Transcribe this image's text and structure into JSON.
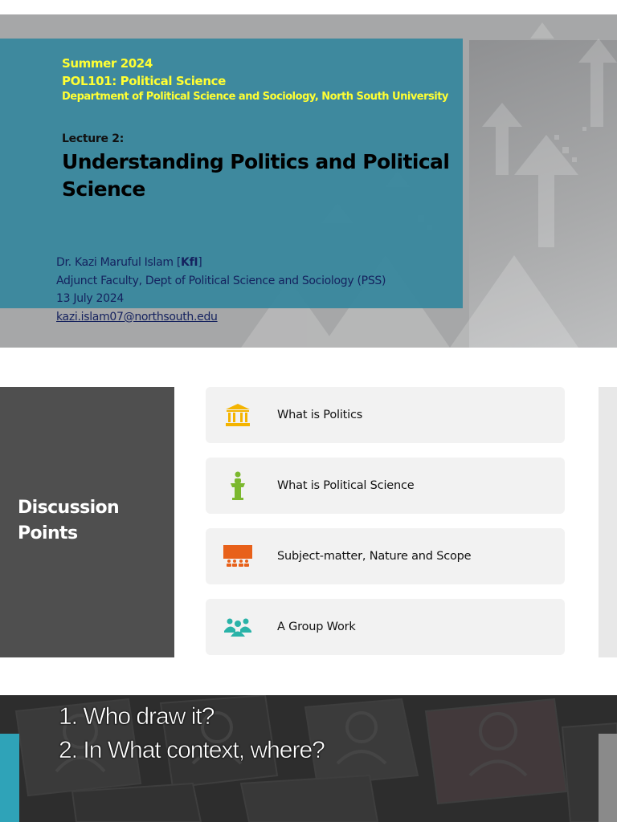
{
  "slide1": {
    "term": "Summer 2024",
    "course": "POL101: Political Science",
    "department": "Department of Political Science and Sociology, North South University",
    "lecture_label": "Lecture 2:",
    "title": "Understanding Politics and Political Science",
    "author_prefix": "Dr. Kazi Maruful Islam [",
    "author_initials": "KfI",
    "author_suffix": "]",
    "position": "Adjunct Faculty, Dept of Political Science and Sociology (PSS)",
    "date": "13 July 2024",
    "email": "kazi.islam07@northsouth.edu",
    "colors": {
      "accent_text": "#ffff33",
      "panel": "#36869d",
      "author_text": "#14215e"
    }
  },
  "slide2": {
    "heading": "Discussion Points",
    "items": [
      {
        "label": "What is Politics",
        "icon": "government-building-icon",
        "color": "#f4b400"
      },
      {
        "label": "What is Political Science",
        "icon": "lectern-speaker-icon",
        "color": "#7cb82f"
      },
      {
        "label": "Subject-matter, Nature and Scope",
        "icon": "presentation-audience-icon",
        "color": "#e8611a"
      },
      {
        "label": "A Group Work",
        "icon": "group-people-icon",
        "color": "#2ab3a8"
      }
    ]
  },
  "slide3": {
    "question1": "1. Who draw it?",
    "question2": "2. In What context, where?"
  }
}
